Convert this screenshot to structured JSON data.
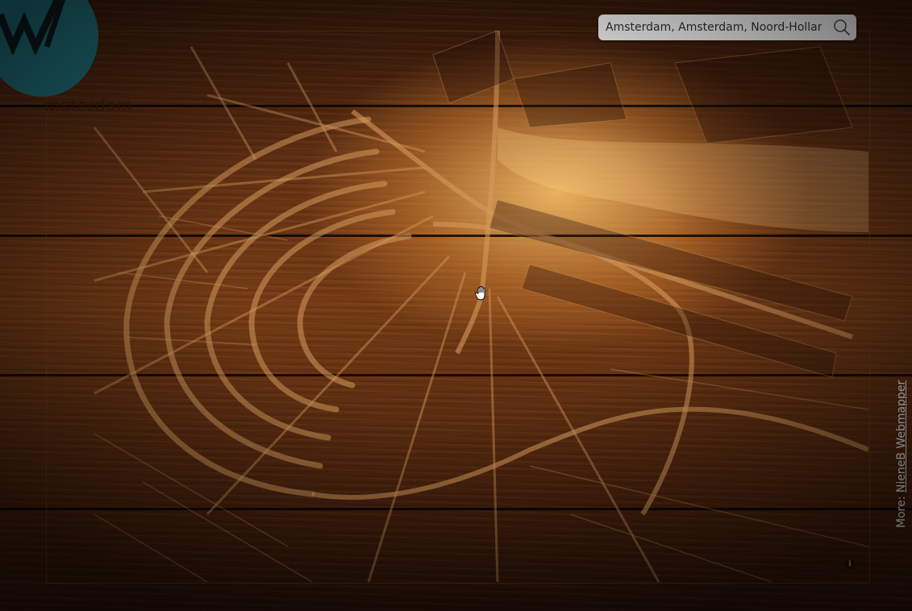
{
  "map": {
    "city_label": "msterdam",
    "search": {
      "value": "Amsterdam, Amsterdam, Noord-Hollan"
    },
    "credit": {
      "prefix": "More: ",
      "link_text": "NieneB Webmapper"
    },
    "info_label": "i"
  },
  "colors": {
    "logo": "#1f6f7a",
    "street": "#d59a5c",
    "water": "#ffd08a"
  }
}
